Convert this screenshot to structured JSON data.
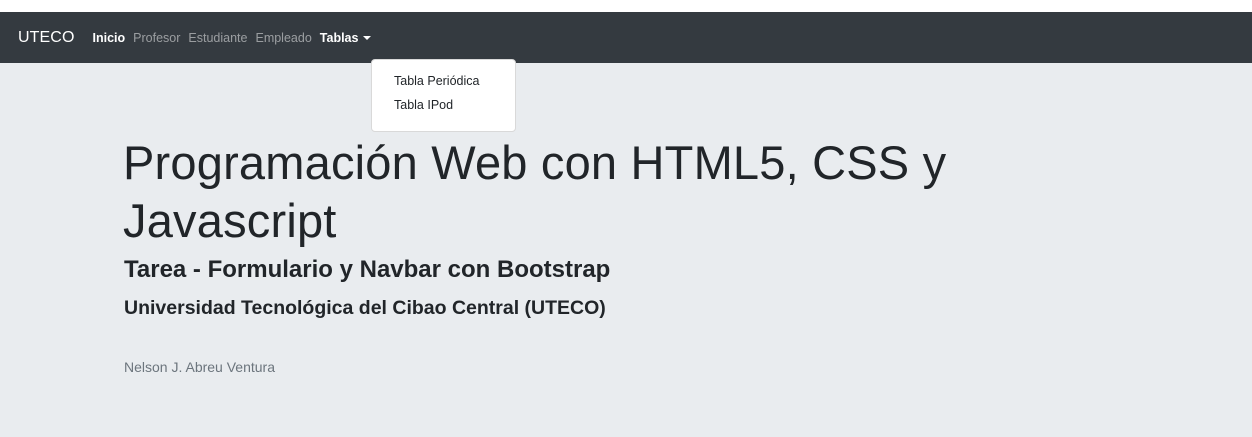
{
  "navbar": {
    "brand": "UTECO",
    "links": [
      {
        "label": "Inicio"
      },
      {
        "label": "Profesor"
      },
      {
        "label": "Estudiante"
      },
      {
        "label": "Empleado"
      },
      {
        "label": "Tablas"
      }
    ],
    "dropdown": {
      "items": [
        {
          "label": "Tabla Periódica"
        },
        {
          "label": "Tabla IPod"
        }
      ]
    }
  },
  "jumbotron": {
    "title": "Programación Web con HTML5, CSS y Javascript",
    "subtitle": "Tarea - Formulario y Navbar con Bootstrap",
    "institution": "Universidad Tecnológica del Cibao Central (UTECO)",
    "author": "Nelson J. Abreu Ventura"
  },
  "colors": {
    "navbar_bg": "#343a40",
    "jumbotron_bg": "#e9ecef",
    "text": "#212529",
    "muted": "#6c757d"
  }
}
